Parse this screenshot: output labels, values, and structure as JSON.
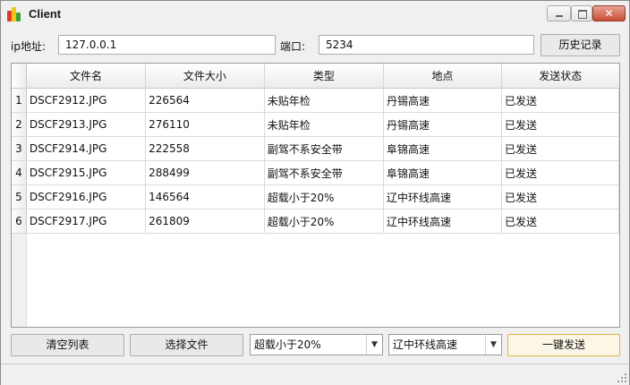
{
  "window": {
    "title": "Client"
  },
  "title_buttons": {
    "minimize_icon": "minimize-icon",
    "maximize_icon": "maximize-icon",
    "close_glyph": "✕"
  },
  "connection": {
    "ip_label": "ip地址:",
    "ip_value": "127.0.0.1",
    "port_label": "端口:",
    "port_value": "5234",
    "history_button": "历史记录"
  },
  "table": {
    "columns": [
      "文件名",
      "文件大小",
      "类型",
      "地点",
      "发送状态"
    ],
    "rows": [
      {
        "num": "1",
        "name": "DSCF2912.JPG",
        "size": "226564",
        "type": "未贴年检",
        "place": "丹锡高速",
        "status": "已发送"
      },
      {
        "num": "2",
        "name": "DSCF2913.JPG",
        "size": "276110",
        "type": "未贴年检",
        "place": "丹锡高速",
        "status": "已发送"
      },
      {
        "num": "3",
        "name": "DSCF2914.JPG",
        "size": "222558",
        "type": "副驾不系安全带",
        "place": "阜锦高速",
        "status": "已发送"
      },
      {
        "num": "4",
        "name": "DSCF2915.JPG",
        "size": "288499",
        "type": "副驾不系安全带",
        "place": "阜锦高速",
        "status": "已发送"
      },
      {
        "num": "5",
        "name": "DSCF2916.JPG",
        "size": "146564",
        "type": "超载小于20%",
        "place": "辽中环线高速",
        "status": "已发送"
      },
      {
        "num": "6",
        "name": "DSCF2917.JPG",
        "size": "261809",
        "type": "超载小于20%",
        "place": "辽中环线高速",
        "status": "已发送"
      }
    ]
  },
  "footer": {
    "clear_button": "清空列表",
    "choose_button": "选择文件",
    "type_select": "超载小于20%",
    "place_select": "辽中环线高速",
    "send_button": "一键发送",
    "dropdown_glyph": "▼"
  }
}
